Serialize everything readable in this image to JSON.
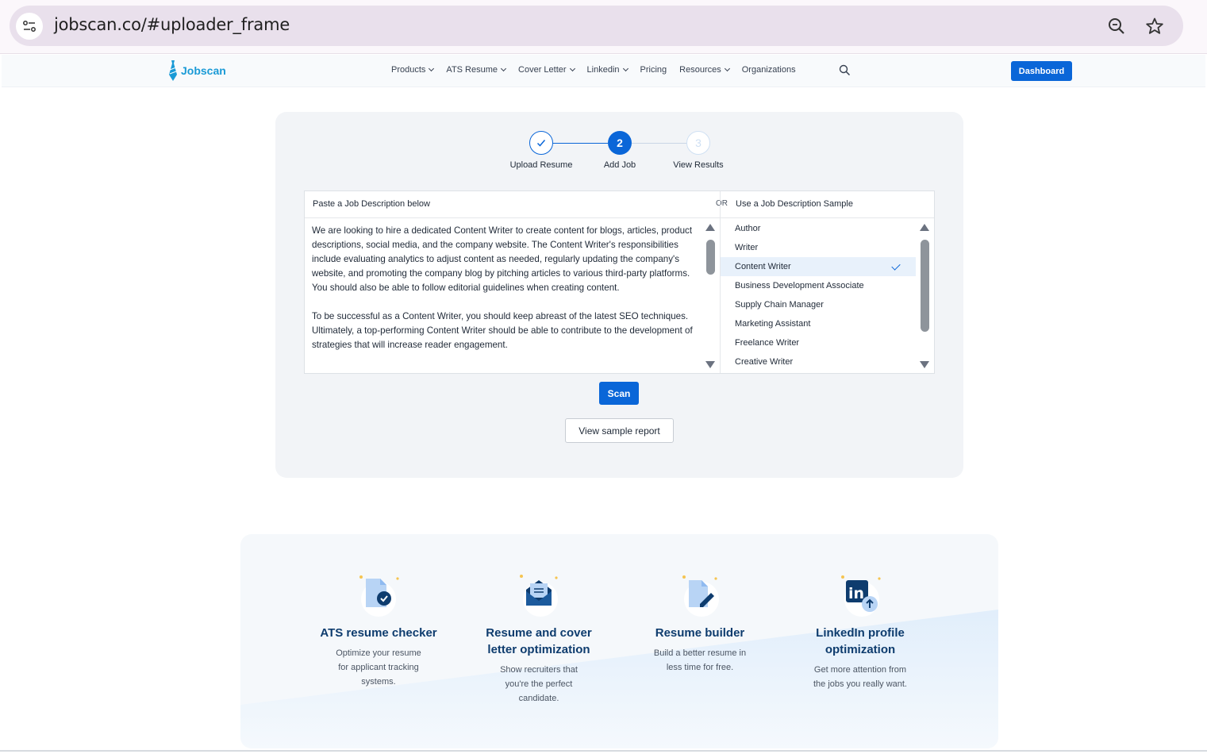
{
  "browser": {
    "url": "jobscan.co/#uploader_frame"
  },
  "nav": {
    "logo_text": "Jobscan",
    "links": [
      {
        "label": "Products",
        "dropdown": true
      },
      {
        "label": "ATS Resume",
        "dropdown": true
      },
      {
        "label": "Cover Letter",
        "dropdown": true
      },
      {
        "label": "Linkedin",
        "dropdown": true
      },
      {
        "label": "Pricing",
        "dropdown": false
      },
      {
        "label": "Resources",
        "dropdown": true
      },
      {
        "label": "Organizations",
        "dropdown": false
      }
    ],
    "dashboard_label": "Dashboard"
  },
  "stepper": {
    "steps": [
      {
        "label": "Upload Resume",
        "state": "done"
      },
      {
        "label": "Add Job",
        "number": "2",
        "state": "active"
      },
      {
        "label": "View Results",
        "number": "3",
        "state": "upcoming"
      }
    ]
  },
  "job_panel": {
    "left_heading": "Paste a Job Description below",
    "or_label": "OR",
    "right_heading": "Use a Job Description Sample",
    "paragraphs": [
      "We are looking to hire a dedicated Content Writer to create content for blogs, articles, product descriptions, social media, and the company website. The Content Writer's responsibilities include evaluating analytics to adjust content as needed, regularly updating the company's website, and promoting the company blog by pitching articles to various third-party platforms. You should also be able to follow editorial guidelines when creating content.",
      "To be successful as a Content Writer, you should keep abreast of the latest SEO techniques. Ultimately, a top-performing Content Writer should be able to contribute to the development of strategies that will increase reader engagement."
    ],
    "samples": [
      "Author",
      "Writer",
      "Content Writer",
      "Business Development Associate",
      "Supply Chain Manager",
      "Marketing Assistant",
      "Freelance Writer",
      "Creative Writer"
    ],
    "selected_sample": "Content Writer"
  },
  "actions": {
    "scan_label": "Scan",
    "sample_report_label": "View sample report"
  },
  "features": [
    {
      "icon": "document-check-icon",
      "title": "ATS resume checker",
      "desc": [
        "Optimize your resume",
        "for applicant tracking",
        "systems."
      ]
    },
    {
      "icon": "envelope-icon",
      "title": "Resume and cover letter optimization",
      "desc": [
        "Show recruiters that",
        "you're the perfect",
        "candidate."
      ]
    },
    {
      "icon": "document-pen-icon",
      "title": "Resume builder",
      "desc": [
        "Build a better resume in",
        "less time for free."
      ]
    },
    {
      "icon": "linkedin-upload-icon",
      "title": "LinkedIn profile optimization",
      "desc": [
        "Get more attention from",
        "the jobs you really want."
      ]
    }
  ],
  "colors": {
    "primary": "#0a66d8",
    "heading": "#0e3c6e",
    "logo": "#1a9ad6"
  }
}
